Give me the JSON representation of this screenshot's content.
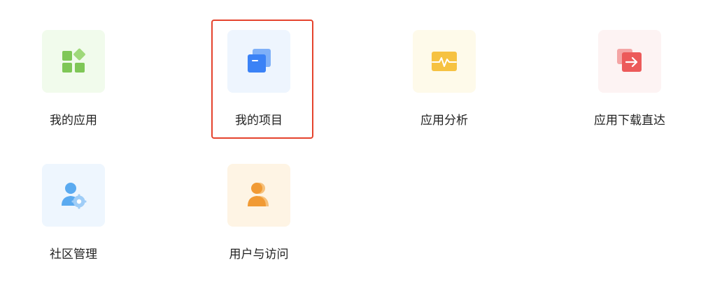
{
  "tiles": [
    {
      "label": "我的应用",
      "icon": "apps-grid-icon",
      "bg": "#f1fbec"
    },
    {
      "label": "我的项目",
      "icon": "projects-stack-icon",
      "bg": "#eef5fe"
    },
    {
      "label": "应用分析",
      "icon": "analytics-pulse-icon",
      "bg": "#fefaea"
    },
    {
      "label": "应用下载直达",
      "icon": "download-direct-icon",
      "bg": "#fdf3f3"
    },
    {
      "label": "社区管理",
      "icon": "community-manage-icon",
      "bg": "#eef6fe"
    },
    {
      "label": "用户与访问",
      "icon": "users-access-icon",
      "bg": "#fef4e4"
    }
  ],
  "selected_label": "我的项目",
  "colors": {
    "selection_border": "#e5432d",
    "green": "#7fc757",
    "blue": "#3b82f6",
    "yellow": "#f6c242",
    "red": "#ec5a5a",
    "sky": "#5aaaf0",
    "orange": "#f19a34"
  }
}
